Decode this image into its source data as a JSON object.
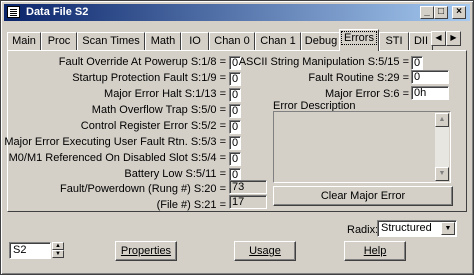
{
  "window": {
    "title": "Data File S2"
  },
  "title_buttons": {
    "minimize": "_",
    "maximize": "□",
    "close": "×"
  },
  "tabs": [
    "Main",
    "Proc",
    "Scan Times",
    "Math",
    "IO",
    "Chan 0",
    "Chan 1",
    "Debug",
    "Errors",
    "STI",
    "DII"
  ],
  "active_tab": "Errors",
  "left_fields": [
    {
      "label": "Fault Override At Powerup S:1/8 =",
      "value": "0"
    },
    {
      "label": "Startup Protection Fault S:1/9 =",
      "value": "0"
    },
    {
      "label": "Major Error Halt S:1/13 =",
      "value": "0"
    },
    {
      "label": "Math Overflow Trap S:5/0 =",
      "value": "0"
    },
    {
      "label": "Control Register Error S:5/2 =",
      "value": "0"
    },
    {
      "label": "Major Error Executing User Fault Rtn. S:5/3 =",
      "value": "0"
    },
    {
      "label": "M0/M1 Referenced On Disabled Slot S:5/4 =",
      "value": "0"
    },
    {
      "label": "Battery Low S:5/11 =",
      "value": "0"
    },
    {
      "label": "Fault/Powerdown (Rung #) S:20 =",
      "value": "73"
    },
    {
      "label": "(File #) S:21 =",
      "value": "17"
    }
  ],
  "right_fields": [
    {
      "label": "ASCII String Manipulation S:5/15 =",
      "value": "0"
    },
    {
      "label": "Fault Routine S:29 =",
      "value": "0"
    },
    {
      "label": "Major Error S:6 =",
      "value": "0h"
    }
  ],
  "error_description": {
    "label": "Error Description",
    "text": ""
  },
  "clear_button": "Clear Major Error",
  "radix": {
    "label": "Radix:",
    "value": "Structured"
  },
  "file_selector": {
    "value": "S2"
  },
  "bottom_buttons": {
    "properties": "Properties",
    "usage": "Usage",
    "help": "Help"
  }
}
